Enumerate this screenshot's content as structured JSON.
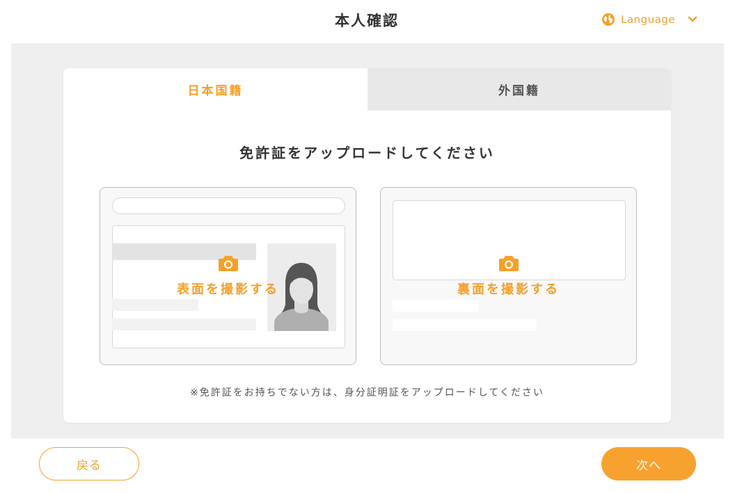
{
  "header": {
    "title": "本人確認",
    "language_label": "Language",
    "language_icon": "globe-icon",
    "dropdown_icon": "chevron-down-icon"
  },
  "tabs": [
    {
      "label": "日本国籍",
      "active": true
    },
    {
      "label": "外国籍",
      "active": false
    }
  ],
  "main": {
    "instruction": "免許証をアップロードしてください",
    "front_upload_label": "表面を撮影する",
    "back_upload_label": "裏面を撮影する",
    "camera_icon": "camera-icon",
    "note": "※免許証をお持ちでない方は、身分証明証をアップロードしてください"
  },
  "footer": {
    "back_label": "戻る",
    "next_label": "次へ"
  },
  "colors": {
    "accent": "#F5A02A",
    "background": "#EFEFEF",
    "card": "#FFFFFF",
    "inactive_tab": "#E8E8E8"
  }
}
